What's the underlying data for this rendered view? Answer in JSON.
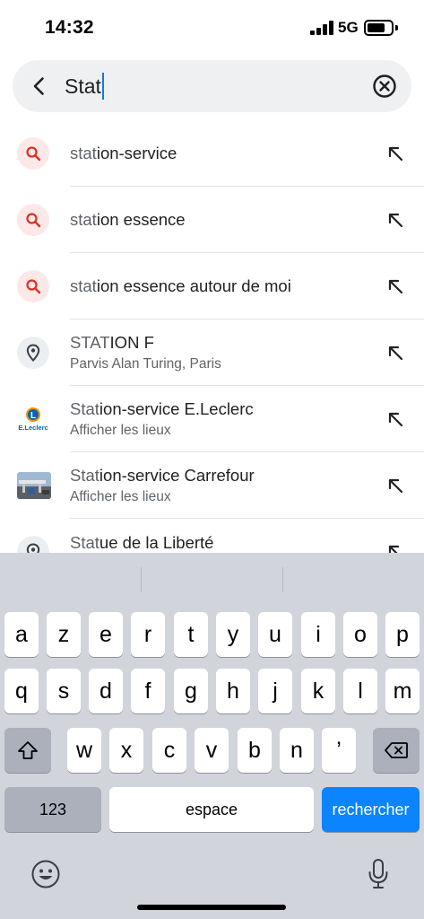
{
  "status_bar": {
    "time": "14:32",
    "network": "5G",
    "signal_bars": 4,
    "battery_level": 0.7
  },
  "search": {
    "query": "Stat",
    "back_icon": "chevron-left-icon",
    "clear_icon": "clear-circle-icon"
  },
  "suggestions": [
    {
      "type": "search",
      "icon": "search-icon",
      "match": "stat",
      "rest": "ion-service",
      "subtitle": ""
    },
    {
      "type": "search",
      "icon": "search-icon",
      "match": "stat",
      "rest": "ion essence",
      "subtitle": ""
    },
    {
      "type": "search",
      "icon": "search-icon",
      "match": "stat",
      "rest": "ion essence autour de moi",
      "subtitle": ""
    },
    {
      "type": "place",
      "icon": "location-pin-icon",
      "match": "STAT",
      "rest": "ION F",
      "subtitle": "Parvis Alan Turing, Paris"
    },
    {
      "type": "logo",
      "icon": "leclerc-logo",
      "logo_text": "E.Leclerc",
      "match": "Stat",
      "rest": "ion-service E.Leclerc",
      "subtitle": "Afficher les lieux"
    },
    {
      "type": "photo",
      "icon": "station-photo",
      "match": "Stat",
      "rest": "ion-service Carrefour",
      "subtitle": "Afficher les lieux"
    },
    {
      "type": "place",
      "icon": "location-pin-icon",
      "match": "Stat",
      "rest": "ue de la Liberté",
      "subtitle": ""
    }
  ],
  "keyboard": {
    "row1": [
      "a",
      "z",
      "e",
      "r",
      "t",
      "y",
      "u",
      "i",
      "o",
      "p"
    ],
    "row2": [
      "q",
      "s",
      "d",
      "f",
      "g",
      "h",
      "j",
      "k",
      "l",
      "m"
    ],
    "row3": [
      "w",
      "x",
      "c",
      "v",
      "b",
      "n",
      "’"
    ],
    "numbers_label": "123",
    "space_label": "espace",
    "return_label": "rechercher",
    "accent_color": "#0b84fe"
  }
}
